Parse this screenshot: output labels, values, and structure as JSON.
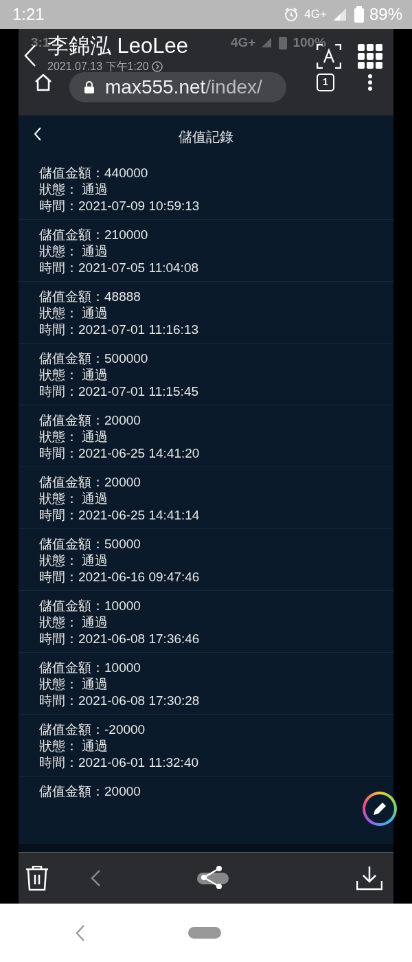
{
  "status_bar": {
    "time": "1:21",
    "network": "4G+",
    "battery": "89%"
  },
  "inner_status_bar": {
    "time": "3:1",
    "network": "4G+",
    "battery": "100%"
  },
  "viewer": {
    "title": "李錦泓 LeoLee",
    "date": "2021.07.13 下午1:20"
  },
  "browser": {
    "url_host": "max555.net",
    "url_path": "/index/",
    "tab_count": "1"
  },
  "page": {
    "title": "儲值記錄",
    "records": [
      {
        "amount": "儲值金額：440000",
        "status": "狀態： 通過",
        "time": "時間：2021-07-09 10:59:13"
      },
      {
        "amount": "儲值金額：210000",
        "status": "狀態： 通過",
        "time": "時間：2021-07-05 11:04:08"
      },
      {
        "amount": "儲值金額：48888",
        "status": "狀態： 通過",
        "time": "時間：2021-07-01 11:16:13"
      },
      {
        "amount": "儲值金額：500000",
        "status": "狀態： 通過",
        "time": "時間：2021-07-01 11:15:45"
      },
      {
        "amount": "儲值金額：20000",
        "status": "狀態： 通過",
        "time": "時間：2021-06-25 14:41:20"
      },
      {
        "amount": "儲值金額：20000",
        "status": "狀態： 通過",
        "time": "時間：2021-06-25 14:41:14"
      },
      {
        "amount": "儲值金額：50000",
        "status": "狀態： 通過",
        "time": "時間：2021-06-16 09:47:46"
      },
      {
        "amount": "儲值金額：10000",
        "status": "狀態： 通過",
        "time": "時間：2021-06-08 17:36:46"
      },
      {
        "amount": "儲值金額：10000",
        "status": "狀態： 通過",
        "time": "時間：2021-06-08 17:30:28"
      },
      {
        "amount": "儲值金額：-20000",
        "status": "狀態： 通過",
        "time": "時間：2021-06-01 11:32:40"
      },
      {
        "amount": "儲值金額：20000"
      }
    ]
  }
}
